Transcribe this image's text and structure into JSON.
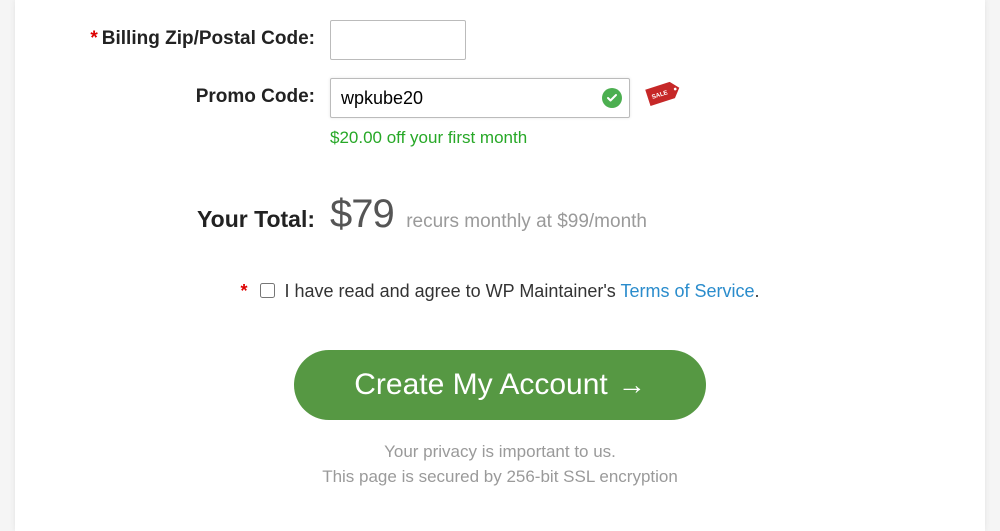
{
  "billing": {
    "zip_label": "Billing Zip/Postal Code:",
    "zip_value": ""
  },
  "promo": {
    "label": "Promo Code:",
    "value": "wpkube20",
    "message": "$20.00 off your first month",
    "tag_text": "SALE"
  },
  "total": {
    "label": "Your Total:",
    "amount": "$79",
    "sub": "recurs monthly at $99/month"
  },
  "terms": {
    "text_before": "I have read and agree to WP Maintainer's ",
    "link_text": "Terms of Service",
    "text_after": "."
  },
  "submit": {
    "label": "Create My Account"
  },
  "privacy": {
    "line1": "Your privacy is important to us.",
    "line2": "This page is secured by 256-bit SSL encryption"
  }
}
